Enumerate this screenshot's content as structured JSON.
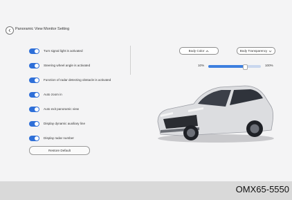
{
  "header": {
    "title": "Panoramic View Monitor Setting"
  },
  "toggles": [
    {
      "label": "Turn signal light is activated",
      "on": true
    },
    {
      "label": "Steering wheel angle is activated",
      "on": true
    },
    {
      "label": "Function of radar detecting obstacle is activated",
      "on": true
    },
    {
      "label": "Auto zoom in",
      "on": true
    },
    {
      "label": "Auto exit panoramic view",
      "on": true
    },
    {
      "label": "Display dynamic auxiliary line",
      "on": true
    },
    {
      "label": "Display radar number",
      "on": true
    }
  ],
  "restore_default": "Restore Default",
  "body_color": {
    "label": "Body Color",
    "icon": "chevron-up-icon"
  },
  "body_transparency": {
    "label": "Body Transparency",
    "icon": "chevron-down-icon"
  },
  "transparency_slider": {
    "min_label": "10%",
    "max_label": "100%",
    "fill_fraction": 0.7
  },
  "caption": "OMX65-5550",
  "colors": {
    "accent": "#2e6fd8",
    "slider_fill": "#3d7fdf",
    "car_body": "#dcdde0"
  }
}
